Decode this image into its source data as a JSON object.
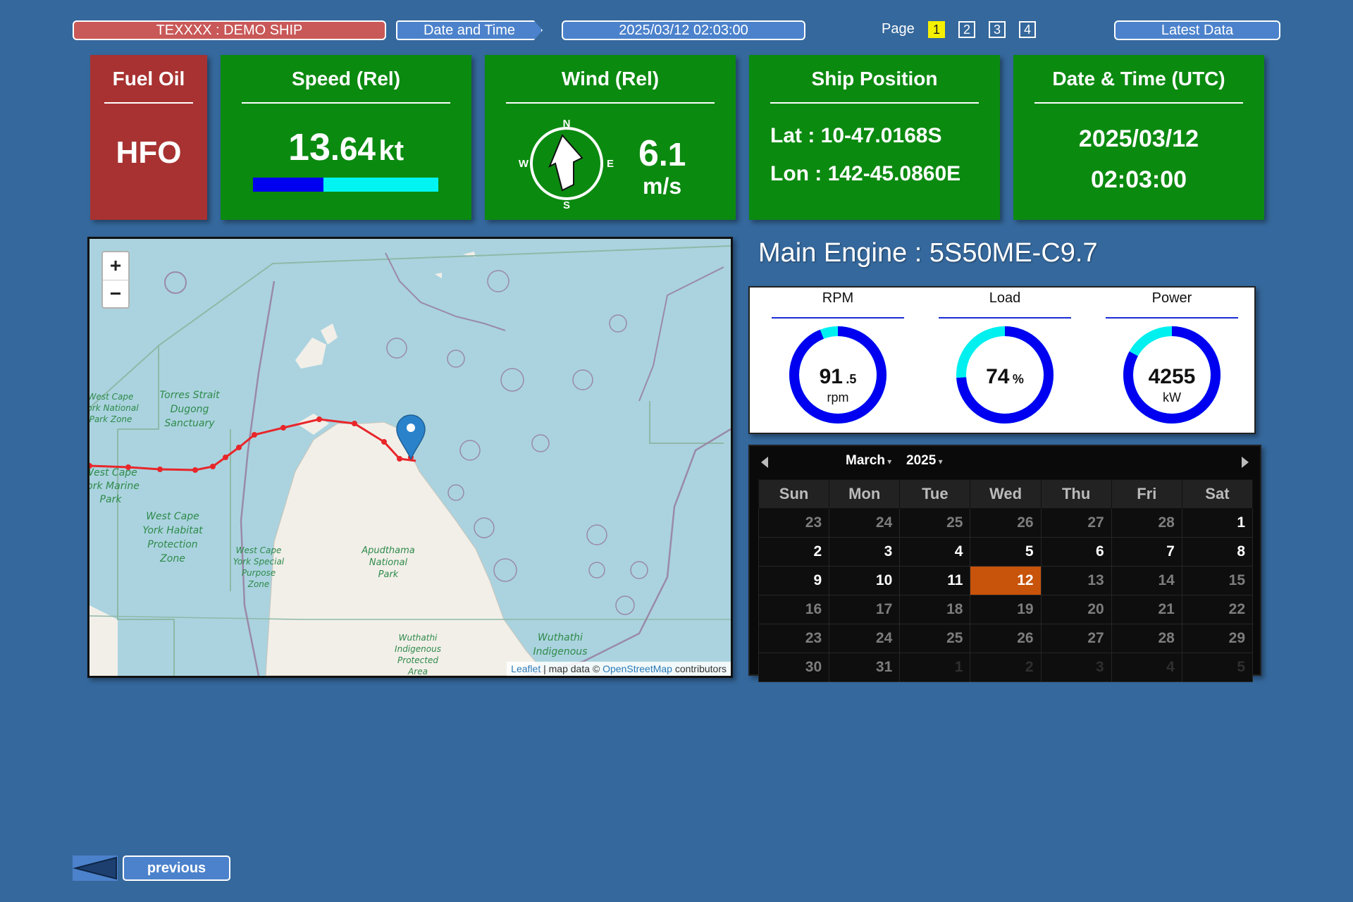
{
  "header": {
    "ship": "TEXXXX : DEMO SHIP",
    "date_time_label": "Date and Time",
    "date_time_value": "2025/03/12 02:03:00",
    "page_label": "Page",
    "pages": [
      "1",
      "2",
      "3",
      "4"
    ],
    "active_page": "1",
    "latest_label": "Latest Data"
  },
  "fuel": {
    "title": "Fuel Oil",
    "value": "HFO"
  },
  "speed": {
    "title": "Speed (Rel)",
    "int": "13",
    "dec": ".64",
    "unit": "kt",
    "bar_fraction": 0.38
  },
  "wind": {
    "title": "Wind (Rel)",
    "int": "6",
    "dec": ".1",
    "unit": "m/s",
    "compass": [
      "N",
      "E",
      "S",
      "W"
    ]
  },
  "position": {
    "title": "Ship Position",
    "lat_label": "Lat :",
    "lat": "10-47.0168S",
    "lon_label": "Lon :",
    "lon": "142-45.0860E"
  },
  "datetime_utc": {
    "title": "Date & Time (UTC)",
    "date": "2025/03/12",
    "time": "02:03:00"
  },
  "map": {
    "zoom_in": "+",
    "zoom_out": "−",
    "attribution_leaflet": "Leaflet",
    "attribution_mid": "| map data ©",
    "attribution_osm": "OpenStreetMap",
    "attribution_end": "contributors",
    "labels": {
      "torres": [
        "Torres Strait",
        "Dugong",
        "Sanctuary"
      ],
      "wcnp": [
        "West Cape",
        "York National",
        "Park Zone"
      ],
      "wcmp": [
        "West Cape",
        "York Marine",
        "Park"
      ],
      "wchp": [
        "West Cape",
        "York Habitat",
        "Protection",
        "Zone"
      ],
      "wcsp": [
        "West Cape",
        "York Special",
        "Purpose",
        "Zone"
      ],
      "apu": [
        "Apudthama",
        "National",
        "Park"
      ],
      "wuth1": [
        "Wuthathi",
        "Indigenous",
        "Protected",
        "Area"
      ],
      "wuth2": [
        "Wuthathi",
        "Indigenous"
      ]
    }
  },
  "engine": {
    "title": "Main Engine : 5S50ME-C9.7",
    "gauges": [
      {
        "label": "RPM",
        "value": "91",
        "dec": ".5",
        "unit": "rpm",
        "fill": 0.94
      },
      {
        "label": "Load",
        "value": "74",
        "dec": "%",
        "unit": "",
        "fill": 0.74
      },
      {
        "label": "Power",
        "value": "4255",
        "dec": "",
        "unit": "kW",
        "fill": 0.83
      }
    ]
  },
  "calendar": {
    "month": "March",
    "year": "2025",
    "weekdays": [
      "Sun",
      "Mon",
      "Tue",
      "Wed",
      "Thu",
      "Fri",
      "Sat"
    ],
    "weeks": [
      [
        [
          "23",
          "out"
        ],
        [
          "24",
          "out"
        ],
        [
          "25",
          "out"
        ],
        [
          "26",
          "out"
        ],
        [
          "27",
          "out"
        ],
        [
          "28",
          "out"
        ],
        [
          "1",
          "bright"
        ]
      ],
      [
        [
          "2",
          "bright"
        ],
        [
          "3",
          "bright"
        ],
        [
          "4",
          "bright"
        ],
        [
          "5",
          "bright"
        ],
        [
          "6",
          "bright"
        ],
        [
          "7",
          "bright"
        ],
        [
          "8",
          "bright"
        ]
      ],
      [
        [
          "9",
          "bright"
        ],
        [
          "10",
          "bright"
        ],
        [
          "11",
          "bright"
        ],
        [
          "12",
          "today"
        ],
        [
          "13",
          "out"
        ],
        [
          "14",
          "out"
        ],
        [
          "15",
          "out"
        ]
      ],
      [
        [
          "16",
          "out"
        ],
        [
          "17",
          "out"
        ],
        [
          "18",
          "out"
        ],
        [
          "19",
          "out"
        ],
        [
          "20",
          "out"
        ],
        [
          "21",
          "out"
        ],
        [
          "22",
          "out"
        ]
      ],
      [
        [
          "23",
          "out"
        ],
        [
          "24",
          "out"
        ],
        [
          "25",
          "out"
        ],
        [
          "26",
          "out"
        ],
        [
          "27",
          "out"
        ],
        [
          "28",
          "out"
        ],
        [
          "29",
          "out"
        ]
      ],
      [
        [
          "30",
          "out"
        ],
        [
          "31",
          "out"
        ],
        [
          "1",
          "next"
        ],
        [
          "2",
          "next"
        ],
        [
          "3",
          "next"
        ],
        [
          "4",
          "next"
        ],
        [
          "5",
          "next"
        ]
      ]
    ]
  },
  "footer": {
    "previous": "previous"
  }
}
